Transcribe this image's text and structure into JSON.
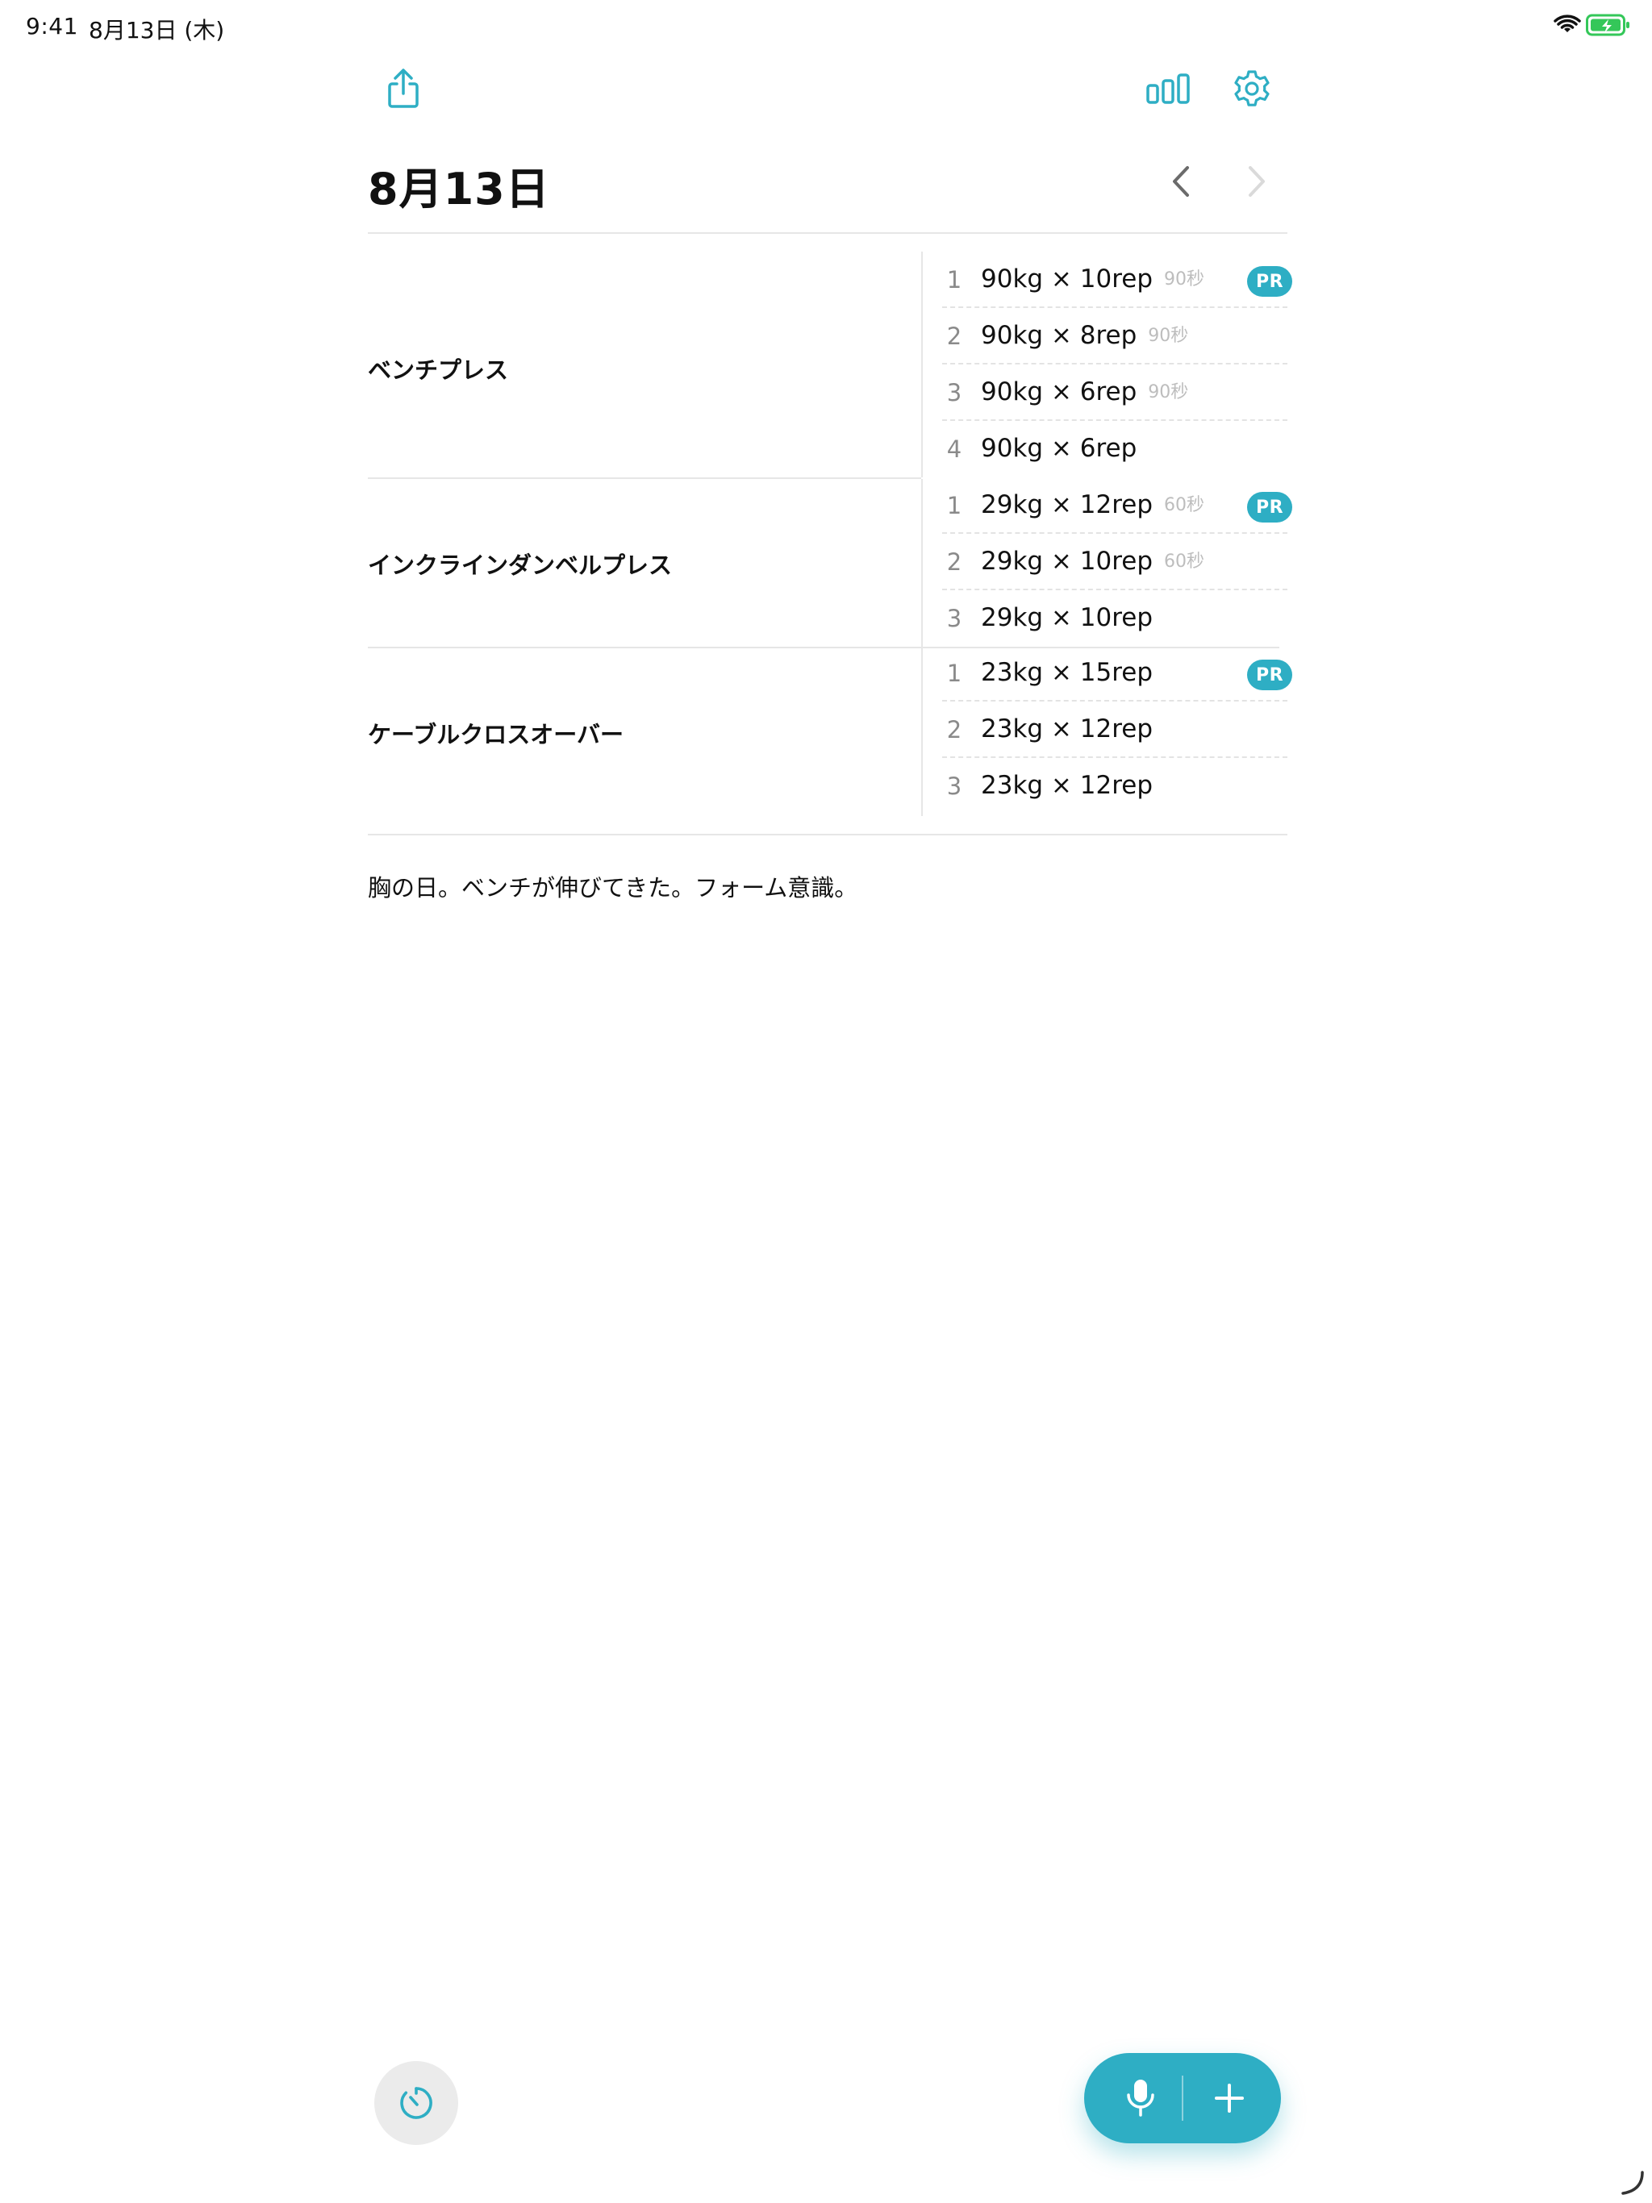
{
  "status_bar": {
    "time": "9:41",
    "date": "8月13日 (木)"
  },
  "colors": {
    "accent": "#2eaec4",
    "text": "#111111",
    "muted": "#8a8a8a",
    "rest": "#bdbdbd",
    "divider": "#e6e6e6"
  },
  "toolbar": {
    "share_icon": "share-icon",
    "stats_icon": "bar-chart-icon",
    "settings_icon": "gear-icon"
  },
  "header": {
    "title": "8月13日"
  },
  "exercises": [
    {
      "name": "ベンチプレス",
      "sets": [
        {
          "num": "1",
          "value": "90kg × 10rep",
          "rest": "90秒",
          "pr": "PR"
        },
        {
          "num": "2",
          "value": "90kg × 8rep",
          "rest": "90秒"
        },
        {
          "num": "3",
          "value": "90kg × 6rep",
          "rest": "90秒"
        },
        {
          "num": "4",
          "value": "90kg × 6rep",
          "rest": ""
        }
      ]
    },
    {
      "name": "インクラインダンベルプレス",
      "sets": [
        {
          "num": "1",
          "value": "29kg × 12rep",
          "rest": "60秒",
          "pr": "PR"
        },
        {
          "num": "2",
          "value": "29kg × 10rep",
          "rest": "60秒"
        },
        {
          "num": "3",
          "value": "29kg × 10rep",
          "rest": ""
        }
      ]
    },
    {
      "name": "ケーブルクロスオーバー",
      "sets": [
        {
          "num": "1",
          "value": "23kg × 15rep",
          "rest": "",
          "pr": "PR"
        },
        {
          "num": "2",
          "value": "23kg × 12rep",
          "rest": ""
        },
        {
          "num": "3",
          "value": "23kg × 12rep",
          "rest": ""
        }
      ]
    }
  ],
  "memo": "胸の日。ベンチが伸びてきた。フォーム意識。",
  "bottom": {
    "timer_icon": "timer-icon",
    "mic_icon": "microphone-icon",
    "add_icon": "plus-icon"
  }
}
